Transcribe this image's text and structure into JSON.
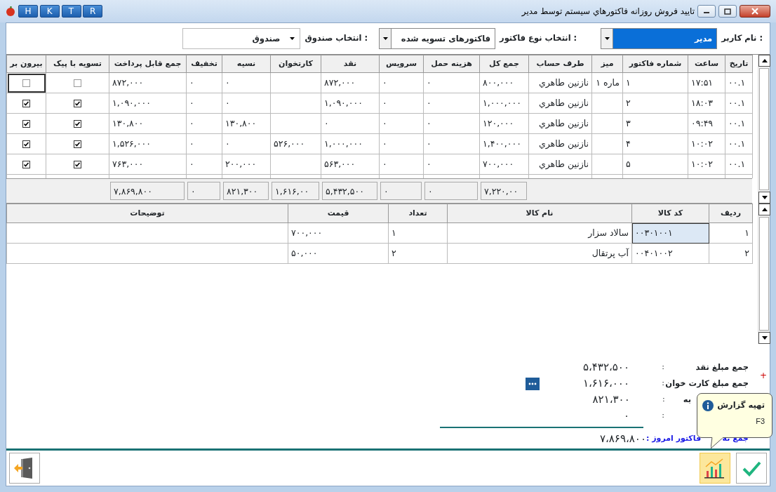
{
  "window": {
    "title": "تایید فروش روزانه فاکتورهاي سیستم توسط مدیر",
    "quick_buttons": [
      "R",
      "T",
      "K",
      "H"
    ]
  },
  "filters": [
    {
      "label": "نام کاربر :",
      "value": "مدیر",
      "highlighted": true,
      "kind": "combo"
    },
    {
      "label": "انتخاب نوع فاکتور :",
      "value": "فاکتورهای تسویه شده",
      "highlighted": false,
      "kind": "combo"
    },
    {
      "label": "انتخاب صندوق :",
      "value": "صندوق",
      "highlighted": false,
      "kind": "dropdown"
    }
  ],
  "invoices": {
    "columns": [
      {
        "label": "تاریخ"
      },
      {
        "label": "ساعت"
      },
      {
        "label": "شماره فاکتور"
      },
      {
        "label": "میز"
      },
      {
        "label": "طرف حساب"
      },
      {
        "label": "جمع کل",
        "total": "۷,۲۲۰,۰۰"
      },
      {
        "label": "هزینه حمل",
        "total": "۰"
      },
      {
        "label": "سرویس",
        "total": "۰"
      },
      {
        "label": "نقد",
        "total": "۵,۴۳۲,۵۰۰"
      },
      {
        "label": "کارتخوان",
        "total": "۱,۶۱۶,۰۰"
      },
      {
        "label": "نسیه",
        "total": "۸۲۱,۳۰۰"
      },
      {
        "label": "تخفیف",
        "total": "۰"
      },
      {
        "label": "جمع قابل پرداخت",
        "total": "۷,۸۶۹,۸۰۰"
      },
      {
        "label": "تسویه با پیک"
      },
      {
        "label": "بیرون بر"
      }
    ],
    "rows": [
      {
        "date": "۰۰.۱",
        "time": "۱۷:۵۱",
        "invoice": "۱",
        "table": "ماره ۱",
        "account": "نازنین طاهري",
        "total": "۸۰۰,۰۰۰",
        "shipping": "۰",
        "service": "۰",
        "cash": "۸۷۲,۰۰۰",
        "credit": "۰",
        "discount": "۰",
        "payable": "۸۷۲,۰۰۰",
        "courier": {
          "checked": false,
          "focused": false
        },
        "takeaway": {
          "checked": false,
          "focused": true
        }
      },
      {
        "date": "۰۰.۱",
        "time": "۱۸:۰۳",
        "invoice": "۲",
        "account": "نازنین طاهري",
        "total": "۱,۰۰۰,۰۰۰",
        "shipping": "۰",
        "service": "۰",
        "cash": "۱,۰۹۰,۰۰۰",
        "credit": "۰",
        "discount": "۰",
        "payable": "۱,۰۹۰,۰۰۰",
        "courier": {
          "checked": true,
          "focused": false
        },
        "takeaway": {
          "checked": true,
          "focused": false
        }
      },
      {
        "date": "۰۰.۱",
        "time": "۰۹:۴۹",
        "invoice": "۳",
        "account": "نازنین طاهري",
        "total": "۱۲۰,۰۰۰",
        "shipping": "۰",
        "service": "۰",
        "cash": "۰",
        "credit": "۱۳۰,۸۰۰",
        "discount": "۰",
        "payable": "۱۳۰,۸۰۰",
        "courier": {
          "checked": true,
          "focused": false
        },
        "takeaway": {
          "checked": true,
          "focused": false
        }
      },
      {
        "date": "۰۰.۱",
        "time": "۱۰:۰۲",
        "invoice": "۴",
        "account": "نازنین طاهري",
        "total": "۱,۴۰۰,۰۰۰",
        "shipping": "۰",
        "service": "۰",
        "cash": "۱,۰۰۰,۰۰۰",
        "card": "۵۲۶,۰۰۰",
        "credit": "۰",
        "discount": "۰",
        "payable": "۱,۵۲۶,۰۰۰",
        "courier": {
          "checked": true,
          "focused": false
        },
        "takeaway": {
          "checked": true,
          "focused": false
        }
      },
      {
        "date": "۰۰.۱",
        "time": "۱۰:۰۲",
        "invoice": "۵",
        "account": "نازنین طاهري",
        "total": "۷۰۰,۰۰۰",
        "shipping": "۰",
        "service": "۰",
        "cash": "۵۶۳,۰۰۰",
        "credit": "۲۰۰,۰۰۰",
        "discount": "۰",
        "payable": "۷۶۳,۰۰۰",
        "courier": {
          "checked": true,
          "focused": false
        },
        "takeaway": {
          "checked": true,
          "focused": false
        }
      }
    ]
  },
  "items": {
    "columns": [
      "ردیف",
      "کد کالا",
      "نام کالا",
      "تعداد",
      "قیمت",
      "توضیحات"
    ],
    "rows": [
      {
        "selected": true,
        "cells": [
          "۱",
          "۰۰۳۰۱۰۰۱",
          "سالاد سزار",
          "۱",
          "۷۰۰,۰۰۰"
        ]
      },
      {
        "selected": false,
        "cells": [
          "۲",
          "۰۰۴۰۱۰۰۲",
          "آب پرتقال",
          "۲",
          "۵۰,۰۰۰"
        ]
      }
    ]
  },
  "summary": {
    "rows": [
      {
        "label": "جمع مبلغ نقد",
        "colon": ":",
        "value": "۵،۴۳۲،۵۰۰"
      },
      {
        "label": "جمع مبلغ کارت خوان",
        "colon": ":",
        "value": "۱،۶۱۶،۰۰۰",
        "has_details": true
      },
      {
        "label": "به",
        "colon": ":",
        "value": "۸۲۱،۳۰۰"
      },
      {
        "colon": ":",
        "value": "۰"
      }
    ],
    "total": {
      "label_start": "جمع ته",
      "label_end": "فاکتور امروز :",
      "value": "۷،۸۶۹،۸۰۰"
    },
    "expand": "+"
  },
  "tooltip": {
    "title": "تهیه گزارش",
    "shortcut": "F3"
  }
}
